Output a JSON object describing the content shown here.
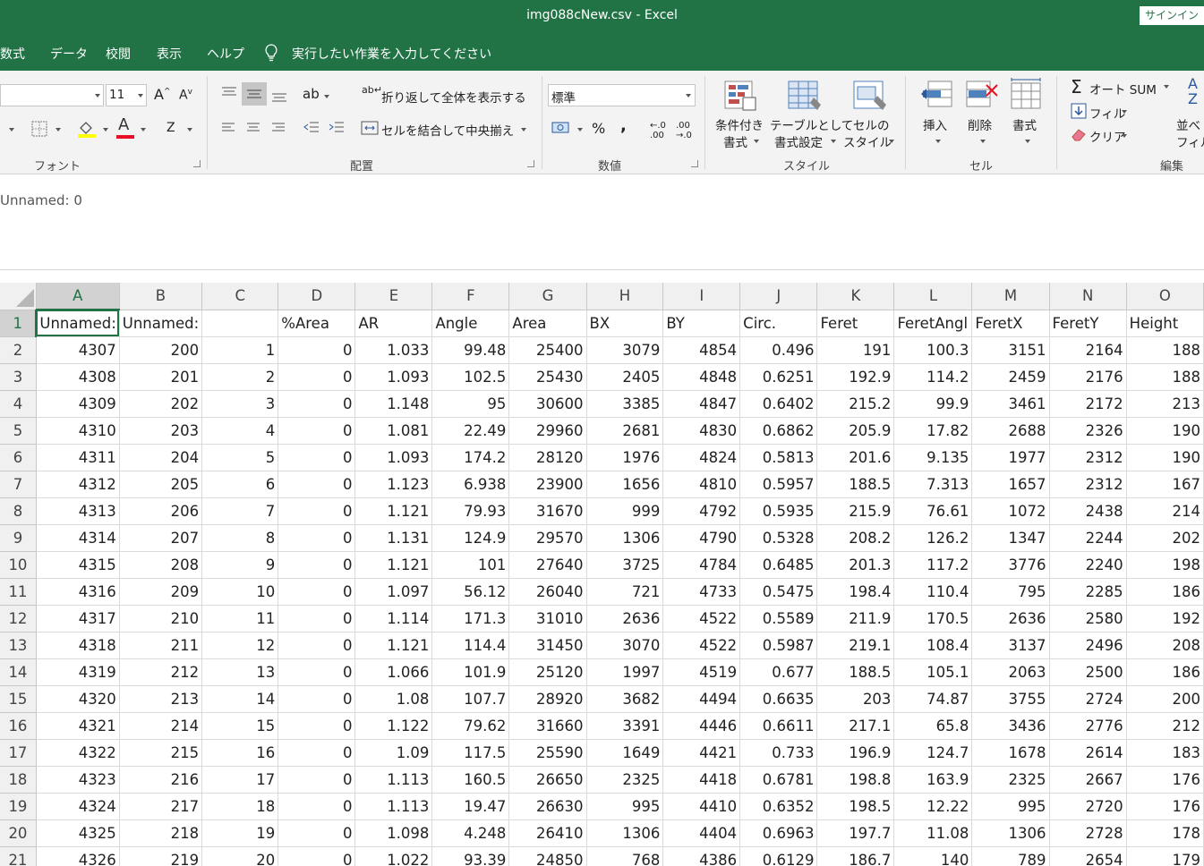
{
  "window": {
    "title": "img088cNew.csv  -  Excel",
    "signin": "サインイン"
  },
  "menu": {
    "items": [
      "数式",
      "データ",
      "校閲",
      "表示",
      "ヘルプ"
    ],
    "tell_me": "実行したい作業を入力してください"
  },
  "ribbon": {
    "font": {
      "size": "11",
      "group_label": "フォント"
    },
    "alignment": {
      "wrap_text": "折り返して全体を表示する",
      "merge_center": "セルを結合して中央揃え",
      "group_label": "配置"
    },
    "number": {
      "format": "標準",
      "percent": "%",
      "comma": ",",
      "group_label": "数値"
    },
    "styles": {
      "conditional_1": "条件付き",
      "conditional_2": "書式",
      "table_1": "テーブルとして",
      "table_2": "書式設定",
      "cell_1": "セルの",
      "cell_2": "スタイル",
      "group_label": "スタイル"
    },
    "cells": {
      "insert": "挿入",
      "delete": "削除",
      "format": "書式",
      "group_label": "セル"
    },
    "editing": {
      "autosum": "オート SUM",
      "fill": "フィル",
      "clear": "クリア",
      "sort_1": "並べ",
      "sort_2": "フィル",
      "group_label": "編集"
    }
  },
  "formula_bar": {
    "content": "Unnamed: 0"
  },
  "sheet": {
    "columns": [
      "A",
      "B",
      "C",
      "D",
      "E",
      "F",
      "G",
      "H",
      "I",
      "J",
      "K",
      "L",
      "M",
      "N",
      "O"
    ],
    "header_row": [
      "Unnamed:",
      "Unnamed:",
      "",
      "%Area",
      "AR",
      "Angle",
      "Area",
      "BX",
      "BY",
      "Circ.",
      "Feret",
      "FeretAngl",
      "FeretX",
      "FeretY",
      "Height"
    ],
    "rows": [
      [
        "4307",
        "200",
        "1",
        "0",
        "1.033",
        "99.48",
        "25400",
        "3079",
        "4854",
        "0.496",
        "191",
        "100.3",
        "3151",
        "2164",
        "188"
      ],
      [
        "4308",
        "201",
        "2",
        "0",
        "1.093",
        "102.5",
        "25430",
        "2405",
        "4848",
        "0.6251",
        "192.9",
        "114.2",
        "2459",
        "2176",
        "188"
      ],
      [
        "4309",
        "202",
        "3",
        "0",
        "1.148",
        "95",
        "30600",
        "3385",
        "4847",
        "0.6402",
        "215.2",
        "99.9",
        "3461",
        "2172",
        "213"
      ],
      [
        "4310",
        "203",
        "4",
        "0",
        "1.081",
        "22.49",
        "29960",
        "2681",
        "4830",
        "0.6862",
        "205.9",
        "17.82",
        "2688",
        "2326",
        "190"
      ],
      [
        "4311",
        "204",
        "5",
        "0",
        "1.093",
        "174.2",
        "28120",
        "1976",
        "4824",
        "0.5813",
        "201.6",
        "9.135",
        "1977",
        "2312",
        "190"
      ],
      [
        "4312",
        "205",
        "6",
        "0",
        "1.123",
        "6.938",
        "23900",
        "1656",
        "4810",
        "0.5957",
        "188.5",
        "7.313",
        "1657",
        "2312",
        "167"
      ],
      [
        "4313",
        "206",
        "7",
        "0",
        "1.121",
        "79.93",
        "31670",
        "999",
        "4792",
        "0.5935",
        "215.9",
        "76.61",
        "1072",
        "2438",
        "214"
      ],
      [
        "4314",
        "207",
        "8",
        "0",
        "1.131",
        "124.9",
        "29570",
        "1306",
        "4790",
        "0.5328",
        "208.2",
        "126.2",
        "1347",
        "2244",
        "202"
      ],
      [
        "4315",
        "208",
        "9",
        "0",
        "1.121",
        "101",
        "27640",
        "3725",
        "4784",
        "0.6485",
        "201.3",
        "117.2",
        "3776",
        "2240",
        "198"
      ],
      [
        "4316",
        "209",
        "10",
        "0",
        "1.097",
        "56.12",
        "26040",
        "721",
        "4733",
        "0.5475",
        "198.4",
        "110.4",
        "795",
        "2285",
        "186"
      ],
      [
        "4317",
        "210",
        "11",
        "0",
        "1.114",
        "171.3",
        "31010",
        "2636",
        "4522",
        "0.5589",
        "211.9",
        "170.5",
        "2636",
        "2580",
        "192"
      ],
      [
        "4318",
        "211",
        "12",
        "0",
        "1.121",
        "114.4",
        "31450",
        "3070",
        "4522",
        "0.5987",
        "219.1",
        "108.4",
        "3137",
        "2496",
        "208"
      ],
      [
        "4319",
        "212",
        "13",
        "0",
        "1.066",
        "101.9",
        "25120",
        "1997",
        "4519",
        "0.677",
        "188.5",
        "105.1",
        "2063",
        "2500",
        "186"
      ],
      [
        "4320",
        "213",
        "14",
        "0",
        "1.08",
        "107.7",
        "28920",
        "3682",
        "4494",
        "0.6635",
        "203",
        "74.87",
        "3755",
        "2724",
        "200"
      ],
      [
        "4321",
        "214",
        "15",
        "0",
        "1.122",
        "79.62",
        "31660",
        "3391",
        "4446",
        "0.6611",
        "217.1",
        "65.8",
        "3436",
        "2776",
        "212"
      ],
      [
        "4322",
        "215",
        "16",
        "0",
        "1.09",
        "117.5",
        "25590",
        "1649",
        "4421",
        "0.733",
        "196.9",
        "124.7",
        "1678",
        "2614",
        "183"
      ],
      [
        "4323",
        "216",
        "17",
        "0",
        "1.113",
        "160.5",
        "26650",
        "2325",
        "4418",
        "0.6781",
        "198.8",
        "163.9",
        "2325",
        "2667",
        "176"
      ],
      [
        "4324",
        "217",
        "18",
        "0",
        "1.113",
        "19.47",
        "26630",
        "995",
        "4410",
        "0.6352",
        "198.5",
        "12.22",
        "995",
        "2720",
        "176"
      ],
      [
        "4325",
        "218",
        "19",
        "0",
        "1.098",
        "4.248",
        "26410",
        "1306",
        "4404",
        "0.6963",
        "197.7",
        "11.08",
        "1306",
        "2728",
        "178"
      ],
      [
        "4326",
        "219",
        "20",
        "0",
        "1.022",
        "93.39",
        "24850",
        "768",
        "4386",
        "0.6129",
        "186.7",
        "140",
        "789",
        "2654",
        "179"
      ]
    ]
  },
  "colors": {
    "accent": "#217346",
    "ribbon_bg": "#f3f3f3",
    "header_bg": "#f0f0f0",
    "font_color_bar": "#e81123",
    "highlight_bar": "#ffff00"
  }
}
